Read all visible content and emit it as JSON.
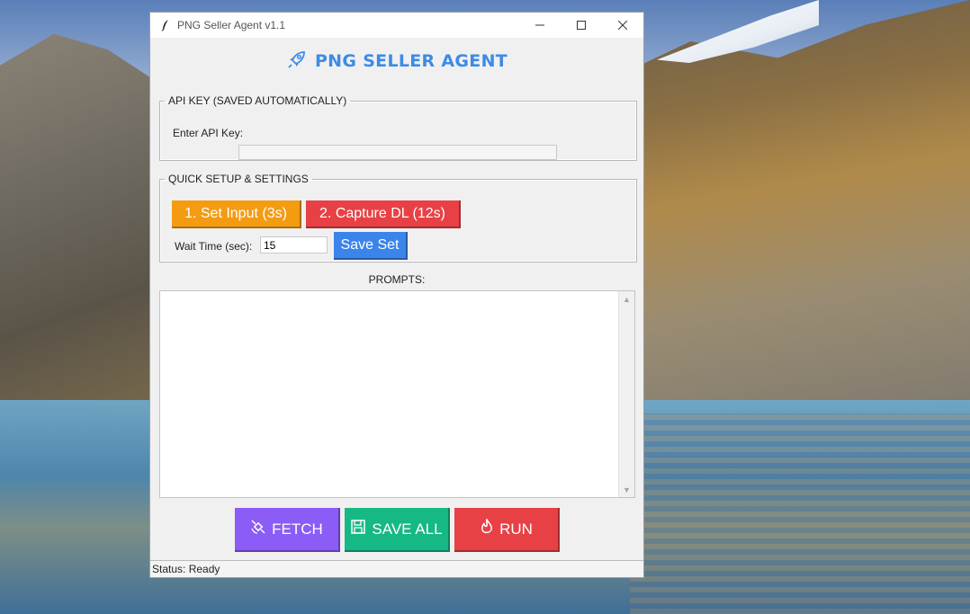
{
  "window": {
    "title": "PNG Seller Agent v1.1",
    "controls": {
      "minimize": "—",
      "maximize": "☐",
      "close": "✕"
    }
  },
  "header": {
    "icon": "rocket-icon",
    "title": "PNG SELLER AGENT"
  },
  "api_group": {
    "title": "API KEY (SAVED AUTOMATICALLY)",
    "label": "Enter API Key:",
    "value": ""
  },
  "setup_group": {
    "title": "QUICK SETUP & SETTINGS",
    "set_input_label": "1. Set Input (3s)",
    "capture_label": "2. Capture DL (12s)",
    "wait_label": "Wait Time (sec):",
    "wait_value": "15",
    "save_set_label": "Save Set"
  },
  "prompts": {
    "label": "PROMPTS:",
    "value": ""
  },
  "actions": {
    "fetch_label": "FETCH",
    "save_all_label": "SAVE ALL",
    "run_label": "RUN"
  },
  "status": {
    "text": "Status: Ready"
  },
  "colors": {
    "accent": "#3d8be6",
    "set_input": "#f39c12",
    "capture": "#e84145",
    "save_set": "#3b84ea",
    "fetch": "#8b5cf6",
    "save_all": "#16b886",
    "run": "#e84145"
  }
}
